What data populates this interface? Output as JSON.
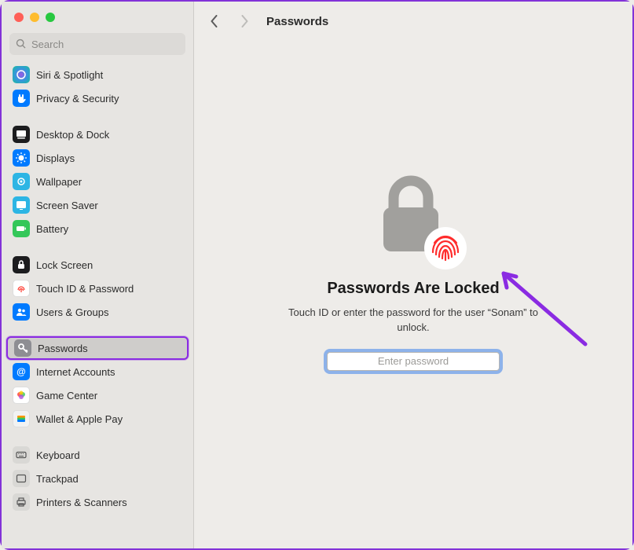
{
  "window": {
    "title": "Passwords"
  },
  "search": {
    "placeholder": "Search"
  },
  "sidebar": {
    "groups": [
      [
        {
          "label": "Siri & Spotlight",
          "icon": "siri"
        },
        {
          "label": "Privacy & Security",
          "icon": "hand"
        }
      ],
      [
        {
          "label": "Desktop & Dock",
          "icon": "dock"
        },
        {
          "label": "Displays",
          "icon": "displays"
        },
        {
          "label": "Wallpaper",
          "icon": "wallpaper"
        },
        {
          "label": "Screen Saver",
          "icon": "screensaver"
        },
        {
          "label": "Battery",
          "icon": "battery"
        }
      ],
      [
        {
          "label": "Lock Screen",
          "icon": "lockscreen"
        },
        {
          "label": "Touch ID & Password",
          "icon": "touchid"
        },
        {
          "label": "Users & Groups",
          "icon": "users"
        }
      ],
      [
        {
          "label": "Passwords",
          "icon": "key",
          "selected": true
        },
        {
          "label": "Internet Accounts",
          "icon": "at"
        },
        {
          "label": "Game Center",
          "icon": "gamecenter"
        },
        {
          "label": "Wallet & Apple Pay",
          "icon": "wallet"
        }
      ],
      [
        {
          "label": "Keyboard",
          "icon": "keyboard"
        },
        {
          "label": "Trackpad",
          "icon": "trackpad"
        },
        {
          "label": "Printers & Scanners",
          "icon": "printer"
        }
      ]
    ]
  },
  "content": {
    "heading": "Passwords Are Locked",
    "subtext": "Touch ID or enter the password for the user “Sonam” to unlock.",
    "password_placeholder": "Enter password"
  },
  "annotations": {
    "arrow_color": "#8a2be2"
  }
}
